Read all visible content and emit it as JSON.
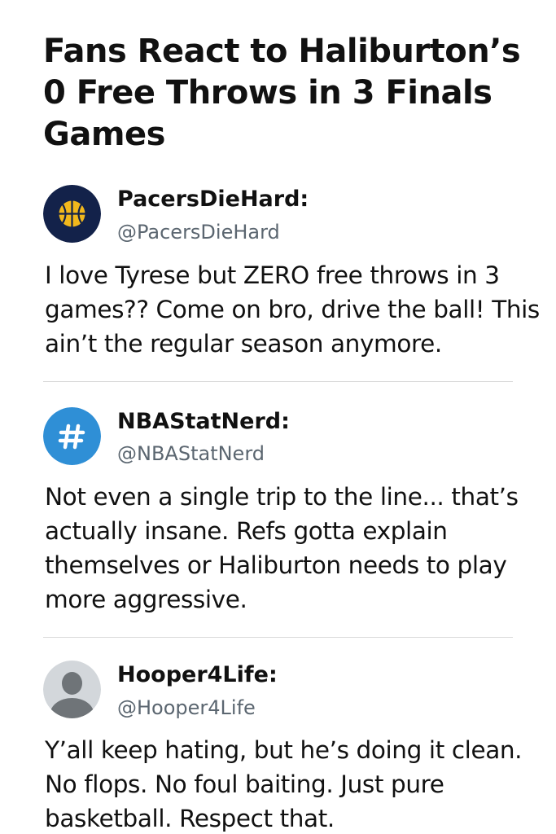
{
  "headline": "Fans React to Haliburton’s 0 Free Throws in 3 Finals Games",
  "posts": [
    {
      "name": "PacersDieHard:",
      "handle": "@PacersDieHard",
      "text": "I love Tyrese but ZERO free throws in 3 games?? Come on bro, drive the ball! This ain’t the regular season anymore.",
      "avatar_icon": "basketball-icon",
      "avatar_bg": "#13224a",
      "avatar_fg": "#f2b81c"
    },
    {
      "name": "NBAStatNerd:",
      "handle": "@NBAStatNerd",
      "text": "Not even a single trip to the line... that’s actually insane. Refs gotta explain themselves or Haliburton needs to play more aggressive.",
      "avatar_icon": "hashtag-icon",
      "avatar_bg": "#2f8fd6",
      "avatar_fg": "#ffffff"
    },
    {
      "name": "Hooper4Life:",
      "handle": "@Hooper4Life",
      "text": "Y’all keep hating, but he’s doing it clean. No flops. No foul baiting. Just pure basketball. Respect that.",
      "avatar_icon": "default-user-icon",
      "avatar_bg": "#d3d7db",
      "avatar_fg": "#6f7478"
    }
  ],
  "colors": {
    "text": "#111111",
    "handle": "#5b6670",
    "divider": "#d9d9d9"
  }
}
